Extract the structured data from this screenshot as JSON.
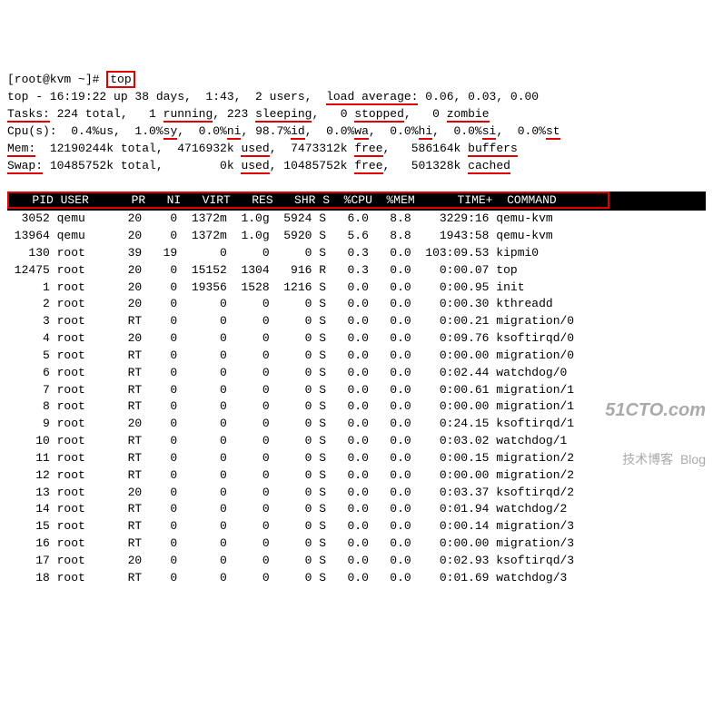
{
  "prompt_user": "root@kvm",
  "prompt_path": "~",
  "command": "top",
  "summary": {
    "prog": "top",
    "time": "16:19:22",
    "up_days": "38",
    "up_hm": "1:43",
    "users": "2",
    "la1": "0.06",
    "la2": "0.03",
    "la3": "0.00",
    "tasks_total": "224",
    "tasks_running": "1",
    "tasks_sleeping": "223",
    "tasks_stopped": "0",
    "tasks_zombie": "0",
    "cpu_us": "0.4",
    "cpu_sy": "1.0",
    "cpu_ni": "0.0",
    "cpu_id": "98.7",
    "cpu_wa": "0.0",
    "cpu_hi": "0.0",
    "cpu_si": "0.0",
    "cpu_st": "0.0",
    "mem_total": "12190244k",
    "mem_used": "4716932k",
    "mem_free": "7473312k",
    "mem_buffers": "586164k",
    "swap_total": "10485752k",
    "swap_used": "0k",
    "swap_free": "10485752k",
    "swap_cached": "501328k"
  },
  "columns": [
    "PID",
    "USER",
    "PR",
    "NI",
    "VIRT",
    "RES",
    "SHR",
    "S",
    "%CPU",
    "%MEM",
    "TIME+",
    "COMMAND"
  ],
  "rows": [
    {
      "pid": "3052",
      "user": "qemu",
      "pr": "20",
      "ni": "0",
      "virt": "1372m",
      "res": "1.0g",
      "shr": "5924",
      "s": "S",
      "cpu": "6.0",
      "mem": "8.8",
      "time": "3229:16",
      "cmd": "qemu-kvm"
    },
    {
      "pid": "13964",
      "user": "qemu",
      "pr": "20",
      "ni": "0",
      "virt": "1372m",
      "res": "1.0g",
      "shr": "5920",
      "s": "S",
      "cpu": "5.6",
      "mem": "8.8",
      "time": "1943:58",
      "cmd": "qemu-kvm"
    },
    {
      "pid": "130",
      "user": "root",
      "pr": "39",
      "ni": "19",
      "virt": "0",
      "res": "0",
      "shr": "0",
      "s": "S",
      "cpu": "0.3",
      "mem": "0.0",
      "time": "103:09.53",
      "cmd": "kipmi0"
    },
    {
      "pid": "12475",
      "user": "root",
      "pr": "20",
      "ni": "0",
      "virt": "15152",
      "res": "1304",
      "shr": "916",
      "s": "R",
      "cpu": "0.3",
      "mem": "0.0",
      "time": "0:00.07",
      "cmd": "top"
    },
    {
      "pid": "1",
      "user": "root",
      "pr": "20",
      "ni": "0",
      "virt": "19356",
      "res": "1528",
      "shr": "1216",
      "s": "S",
      "cpu": "0.0",
      "mem": "0.0",
      "time": "0:00.95",
      "cmd": "init"
    },
    {
      "pid": "2",
      "user": "root",
      "pr": "20",
      "ni": "0",
      "virt": "0",
      "res": "0",
      "shr": "0",
      "s": "S",
      "cpu": "0.0",
      "mem": "0.0",
      "time": "0:00.30",
      "cmd": "kthreadd"
    },
    {
      "pid": "3",
      "user": "root",
      "pr": "RT",
      "ni": "0",
      "virt": "0",
      "res": "0",
      "shr": "0",
      "s": "S",
      "cpu": "0.0",
      "mem": "0.0",
      "time": "0:00.21",
      "cmd": "migration/0"
    },
    {
      "pid": "4",
      "user": "root",
      "pr": "20",
      "ni": "0",
      "virt": "0",
      "res": "0",
      "shr": "0",
      "s": "S",
      "cpu": "0.0",
      "mem": "0.0",
      "time": "0:09.76",
      "cmd": "ksoftirqd/0"
    },
    {
      "pid": "5",
      "user": "root",
      "pr": "RT",
      "ni": "0",
      "virt": "0",
      "res": "0",
      "shr": "0",
      "s": "S",
      "cpu": "0.0",
      "mem": "0.0",
      "time": "0:00.00",
      "cmd": "migration/0"
    },
    {
      "pid": "6",
      "user": "root",
      "pr": "RT",
      "ni": "0",
      "virt": "0",
      "res": "0",
      "shr": "0",
      "s": "S",
      "cpu": "0.0",
      "mem": "0.0",
      "time": "0:02.44",
      "cmd": "watchdog/0"
    },
    {
      "pid": "7",
      "user": "root",
      "pr": "RT",
      "ni": "0",
      "virt": "0",
      "res": "0",
      "shr": "0",
      "s": "S",
      "cpu": "0.0",
      "mem": "0.0",
      "time": "0:00.61",
      "cmd": "migration/1"
    },
    {
      "pid": "8",
      "user": "root",
      "pr": "RT",
      "ni": "0",
      "virt": "0",
      "res": "0",
      "shr": "0",
      "s": "S",
      "cpu": "0.0",
      "mem": "0.0",
      "time": "0:00.00",
      "cmd": "migration/1"
    },
    {
      "pid": "9",
      "user": "root",
      "pr": "20",
      "ni": "0",
      "virt": "0",
      "res": "0",
      "shr": "0",
      "s": "S",
      "cpu": "0.0",
      "mem": "0.0",
      "time": "0:24.15",
      "cmd": "ksoftirqd/1"
    },
    {
      "pid": "10",
      "user": "root",
      "pr": "RT",
      "ni": "0",
      "virt": "0",
      "res": "0",
      "shr": "0",
      "s": "S",
      "cpu": "0.0",
      "mem": "0.0",
      "time": "0:03.02",
      "cmd": "watchdog/1"
    },
    {
      "pid": "11",
      "user": "root",
      "pr": "RT",
      "ni": "0",
      "virt": "0",
      "res": "0",
      "shr": "0",
      "s": "S",
      "cpu": "0.0",
      "mem": "0.0",
      "time": "0:00.15",
      "cmd": "migration/2"
    },
    {
      "pid": "12",
      "user": "root",
      "pr": "RT",
      "ni": "0",
      "virt": "0",
      "res": "0",
      "shr": "0",
      "s": "S",
      "cpu": "0.0",
      "mem": "0.0",
      "time": "0:00.00",
      "cmd": "migration/2"
    },
    {
      "pid": "13",
      "user": "root",
      "pr": "20",
      "ni": "0",
      "virt": "0",
      "res": "0",
      "shr": "0",
      "s": "S",
      "cpu": "0.0",
      "mem": "0.0",
      "time": "0:03.37",
      "cmd": "ksoftirqd/2"
    },
    {
      "pid": "14",
      "user": "root",
      "pr": "RT",
      "ni": "0",
      "virt": "0",
      "res": "0",
      "shr": "0",
      "s": "S",
      "cpu": "0.0",
      "mem": "0.0",
      "time": "0:01.94",
      "cmd": "watchdog/2"
    },
    {
      "pid": "15",
      "user": "root",
      "pr": "RT",
      "ni": "0",
      "virt": "0",
      "res": "0",
      "shr": "0",
      "s": "S",
      "cpu": "0.0",
      "mem": "0.0",
      "time": "0:00.14",
      "cmd": "migration/3"
    },
    {
      "pid": "16",
      "user": "root",
      "pr": "RT",
      "ni": "0",
      "virt": "0",
      "res": "0",
      "shr": "0",
      "s": "S",
      "cpu": "0.0",
      "mem": "0.0",
      "time": "0:00.00",
      "cmd": "migration/3"
    },
    {
      "pid": "17",
      "user": "root",
      "pr": "20",
      "ni": "0",
      "virt": "0",
      "res": "0",
      "shr": "0",
      "s": "S",
      "cpu": "0.0",
      "mem": "0.0",
      "time": "0:02.93",
      "cmd": "ksoftirqd/3"
    },
    {
      "pid": "18",
      "user": "root",
      "pr": "RT",
      "ni": "0",
      "virt": "0",
      "res": "0",
      "shr": "0",
      "s": "S",
      "cpu": "0.0",
      "mem": "0.0",
      "time": "0:01.69",
      "cmd": "watchdog/3"
    }
  ],
  "watermark": {
    "main": "51CTO.com",
    "sub": "技术博客",
    "tag": "Blog"
  }
}
